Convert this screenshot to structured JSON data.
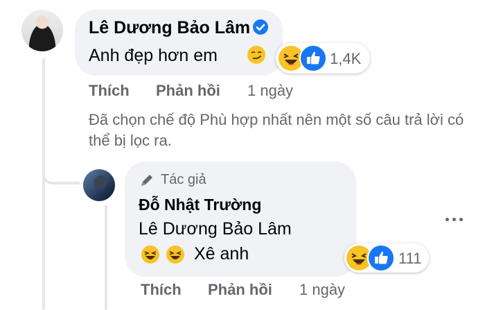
{
  "comment": {
    "author": "Lê Dương Bảo Lâm",
    "text": "Anh đẹp hơn em",
    "reaction_count": "1,4K",
    "actions": {
      "like": "Thích",
      "reply": "Phản hồi",
      "time": "1 ngày"
    }
  },
  "filter_notice": "Đã chọn chế độ Phù hợp nhất nên một số câu trả lời có thể bị lọc ra.",
  "reply": {
    "badge": "Tác giả",
    "author": "Đỗ Nhật Trường",
    "tag": "Lê Dương Bảo Lâm",
    "text": "Xê anh",
    "reaction_count": "111",
    "actions": {
      "like": "Thích",
      "reply": "Phản hồi",
      "time": "1 ngày"
    }
  },
  "colors": {
    "bubble": "#f0f2f5",
    "secondary_text": "#65676b",
    "like_blue": "#1877f2",
    "haha_yellow": "#f7c325"
  },
  "icons": [
    "verified-badge-icon",
    "smirk-emoji-icon",
    "haha-reaction-icon",
    "like-reaction-icon",
    "pencil-icon",
    "laughing-emoji-icon",
    "more-options-icon"
  ]
}
